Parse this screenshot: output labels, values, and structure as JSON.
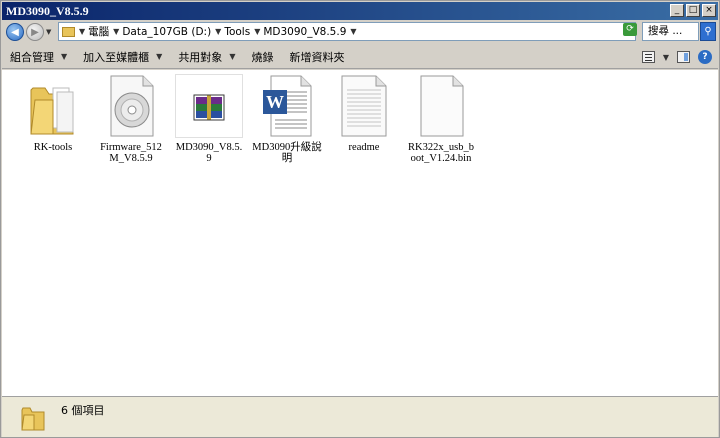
{
  "window": {
    "title": "MD3090_V8.5.9",
    "minimize_glyph": "_",
    "maximize_glyph": "□",
    "close_glyph": "×"
  },
  "address": {
    "crumbs": [
      "電腦",
      "Data_107GB (D:)",
      "Tools",
      "MD3090_V8.5.9"
    ],
    "search_placeholder": "搜尋 ..."
  },
  "toolbar": {
    "organize": "組合管理",
    "add_to_library": "加入至媒體櫃",
    "share_with": "共用對象",
    "burn": "燒錄",
    "new_folder": "新增資料夾"
  },
  "files": [
    {
      "name": "RK-tools",
      "icon": "folder-icon"
    },
    {
      "name": "Firmware_512M_V8.5.9",
      "icon": "disc-image-icon"
    },
    {
      "name": "MD3090_V8.5.9",
      "icon": "winrar-archive-icon"
    },
    {
      "name": "MD3090升級說明",
      "icon": "word-document-icon"
    },
    {
      "name": "readme",
      "icon": "text-file-icon"
    },
    {
      "name": "RK322x_usb_boot_V1.24.bin",
      "icon": "blank-file-icon"
    }
  ],
  "status": {
    "item_count": "6 個項目"
  },
  "colors": {
    "titlebar_start": "#0a246a",
    "titlebar_end": "#3a6ea5",
    "folder": "#e8c45a",
    "word_blue": "#2b579a"
  }
}
